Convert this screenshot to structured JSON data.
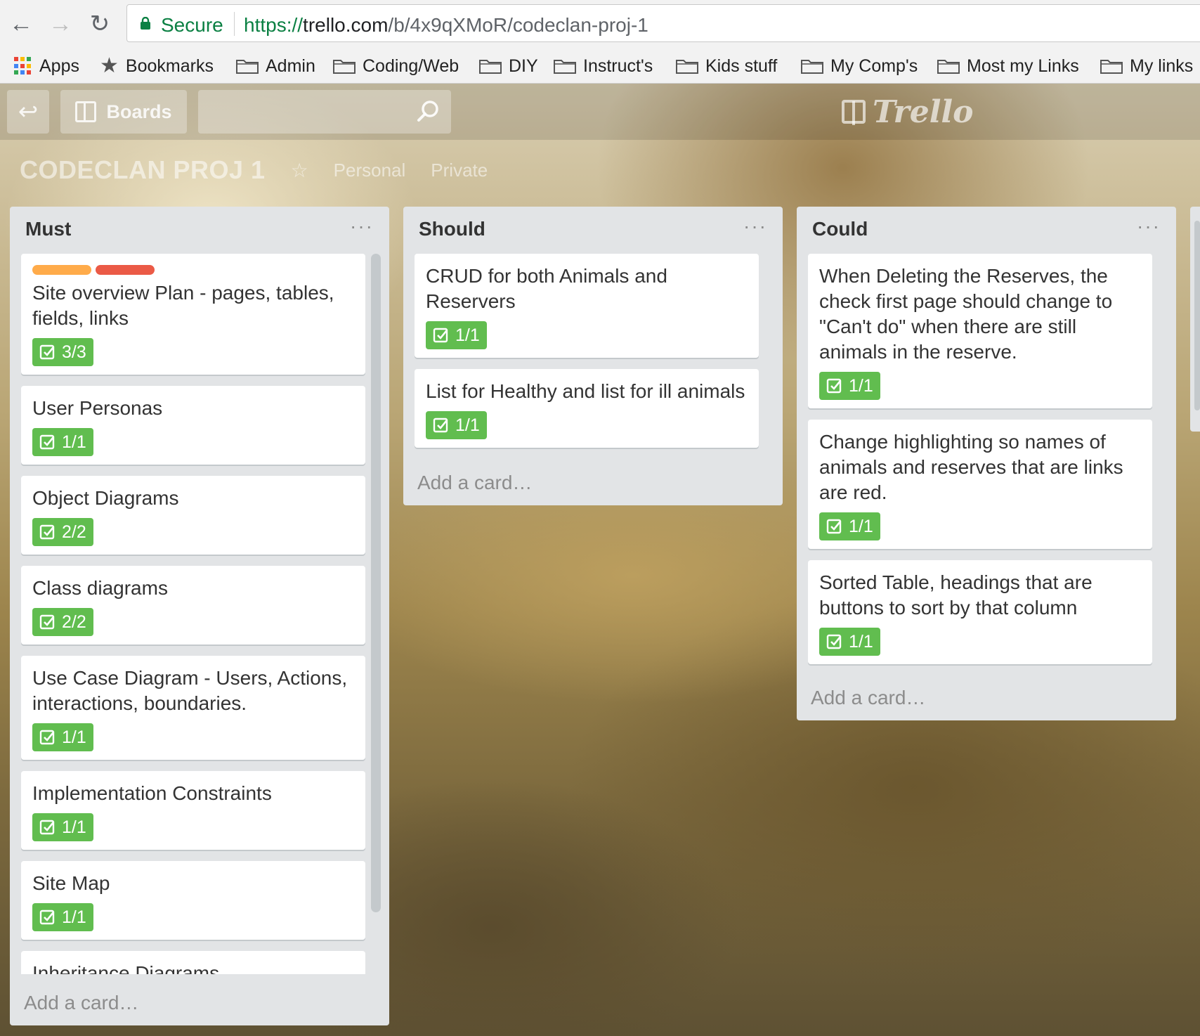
{
  "browser": {
    "secure_label": "Secure",
    "url_scheme": "https://",
    "url_host": "trello.com",
    "url_path": "/b/4x9qXMoR/codeclan-proj-1"
  },
  "bookmarks": [
    {
      "label": "Apps",
      "icon": "apps-grid-icon"
    },
    {
      "label": "Bookmarks",
      "icon": "star-icon"
    },
    {
      "label": "Admin",
      "icon": "folder-icon"
    },
    {
      "label": "Coding/Web",
      "icon": "folder-icon"
    },
    {
      "label": "DIY",
      "icon": "folder-icon"
    },
    {
      "label": "Instruct's",
      "icon": "folder-icon"
    },
    {
      "label": "Kids stuff",
      "icon": "folder-icon"
    },
    {
      "label": "My Comp's",
      "icon": "folder-icon"
    },
    {
      "label": "Most my Links",
      "icon": "folder-icon"
    },
    {
      "label": "My links",
      "icon": "folder-icon"
    }
  ],
  "header": {
    "boards_label": "Boards",
    "logo_text": "Trello"
  },
  "board": {
    "name": "CODECLAN PROJ 1",
    "team": "Personal",
    "visibility": "Private"
  },
  "lists": [
    {
      "title": "Must",
      "menu": "···",
      "add_card": "Add a card…",
      "cards": [
        {
          "title": "Site overview Plan - pages, tables, fields, links",
          "labels": [
            "#ffab4a",
            "#eb5a46"
          ],
          "checklist": "3/3"
        },
        {
          "title": "User Personas",
          "checklist": "1/1"
        },
        {
          "title": "Object Diagrams",
          "checklist": "2/2"
        },
        {
          "title": "Class diagrams",
          "checklist": "2/2"
        },
        {
          "title": "Use Case Diagram - Users, Actions, interactions, boundaries.",
          "checklist": "1/1"
        },
        {
          "title": "Implementation Constraints",
          "checklist": "1/1"
        },
        {
          "title": "Site Map",
          "checklist": "1/1"
        },
        {
          "title": "Inheritance Diagrams"
        }
      ]
    },
    {
      "title": "Should",
      "menu": "···",
      "add_card": "Add a card…",
      "cards": [
        {
          "title": "CRUD for both Animals and Reservers",
          "checklist": "1/1"
        },
        {
          "title": "List for Healthy and list for ill animals",
          "checklist": "1/1"
        }
      ]
    },
    {
      "title": "Could",
      "menu": "···",
      "add_card": "Add a card…",
      "cards": [
        {
          "title": "When Deleting the Reserves, the check first page should change to \"Can't do\" when there are still animals in the reserve.",
          "checklist": "1/1"
        },
        {
          "title": "Change highlighting so names of animals and reserves that are links are red.",
          "checklist": "1/1"
        },
        {
          "title": "Sorted Table, headings that are buttons to sort by that column",
          "checklist": "1/1"
        }
      ]
    }
  ],
  "colors": {
    "badge_complete": "#61bd4f",
    "list_bg": "#e2e4e6",
    "label_orange": "#ffab4a",
    "label_red": "#eb5a46"
  }
}
